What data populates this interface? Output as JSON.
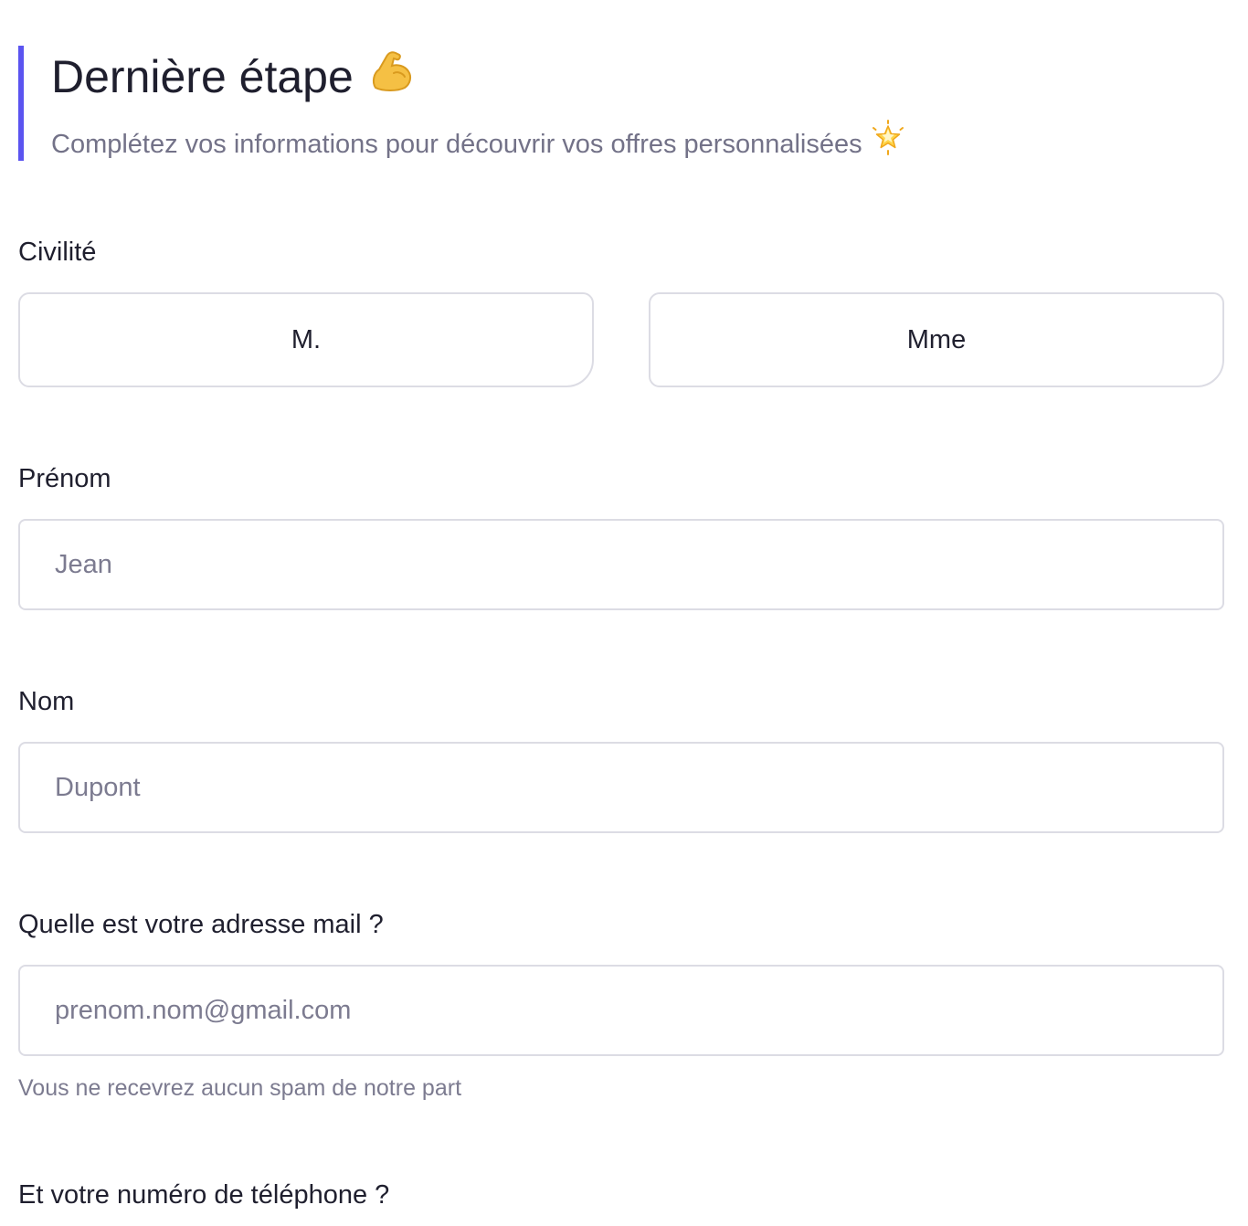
{
  "header": {
    "title": "Dernière étape",
    "title_emoji": "flexed-biceps",
    "subtitle": "Complétez vos informations pour découvrir vos offres personnalisées",
    "subtitle_emoji": "glowing-star",
    "accent_color": "#5b54f0"
  },
  "civility": {
    "label": "Civilité",
    "options": [
      "M.",
      "Mme"
    ]
  },
  "first_name": {
    "label": "Prénom",
    "value": "",
    "placeholder": "Jean"
  },
  "last_name": {
    "label": "Nom",
    "value": "",
    "placeholder": "Dupont"
  },
  "email": {
    "label": "Quelle est votre adresse mail ?",
    "value": "",
    "placeholder": "prenom.nom@gmail.com",
    "help": "Vous ne recevrez aucun spam de notre part"
  },
  "phone": {
    "label": "Et votre numéro de téléphone ?"
  }
}
